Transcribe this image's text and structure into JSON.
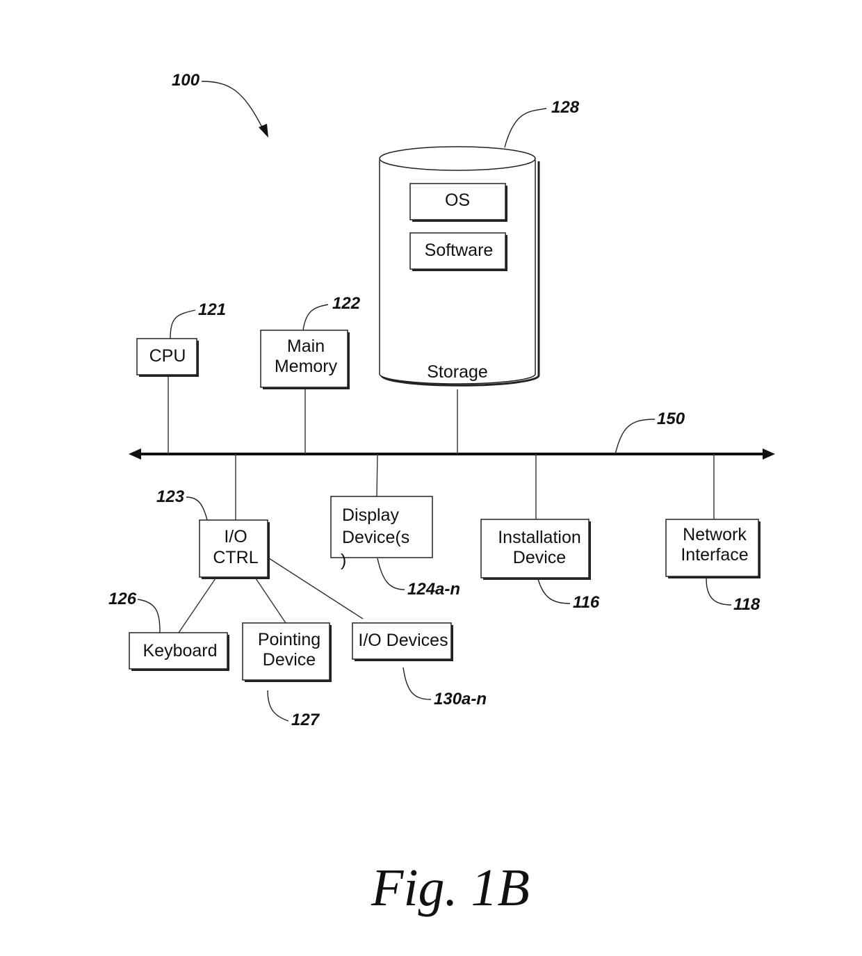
{
  "figure": {
    "title": "Fig. 1B",
    "system_ref": "100"
  },
  "storage": {
    "label": "Storage",
    "ref": "128",
    "contents": [
      "OS",
      "Software"
    ]
  },
  "bus": {
    "ref": "150"
  },
  "components": {
    "cpu": {
      "lines": [
        "CPU"
      ],
      "ref": "121"
    },
    "main_memory": {
      "lines": [
        "Main",
        "Memory"
      ],
      "ref": "122"
    },
    "io_ctrl": {
      "lines": [
        "I/O",
        "CTRL"
      ],
      "ref": "123"
    },
    "display": {
      "lines": [
        "Display",
        "Device(s",
        ")"
      ],
      "ref": "124a-n"
    },
    "installation": {
      "lines": [
        "Installation",
        "Device"
      ],
      "ref": "116"
    },
    "network": {
      "lines": [
        "Network",
        "Interface"
      ],
      "ref": "118"
    },
    "keyboard": {
      "lines": [
        "Keyboard"
      ],
      "ref": "126"
    },
    "pointing": {
      "lines": [
        "Pointing",
        "Device"
      ],
      "ref": "127"
    },
    "io_devices": {
      "lines": [
        "I/O Devices"
      ],
      "ref": "130a-n"
    }
  }
}
